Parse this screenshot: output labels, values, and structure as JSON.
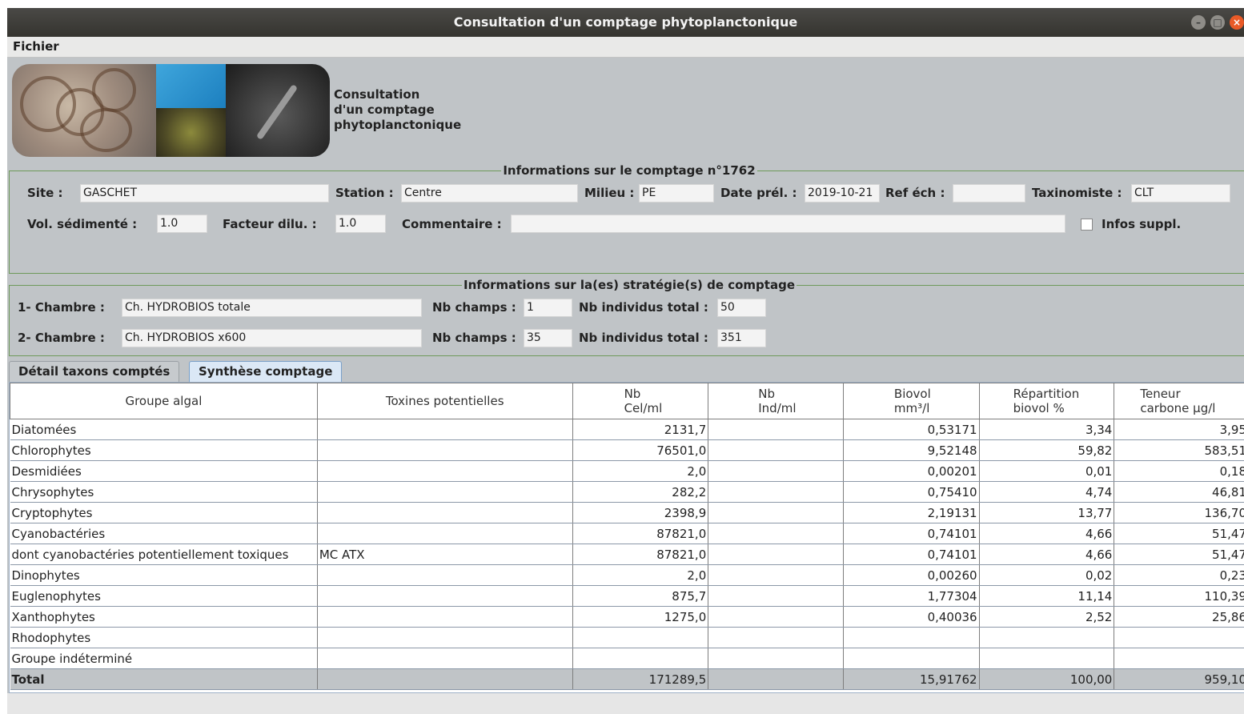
{
  "window": {
    "title": "Consultation d'un comptage phytoplanctonique"
  },
  "menu": {
    "fichier": "Fichier"
  },
  "banner": {
    "caption": [
      "Consultation",
      "d'un comptage",
      "phytoplanctonique"
    ]
  },
  "info": {
    "legend": "Informations sur le comptage n°1762",
    "site_label": "Site :",
    "site_value": "GASCHET",
    "station_label": "Station :",
    "station_value": "Centre",
    "milieu_label": "Milieu :",
    "milieu_value": "PE",
    "date_label": "Date prél. :",
    "date_value": "2019-10-21",
    "ref_label": "Ref éch :",
    "ref_value": "",
    "taxo_label": "Taxinomiste :",
    "taxo_value": "CLT",
    "vol_label": "Vol. sédimenté :",
    "vol_value": "1.0",
    "facteur_label": "Facteur dilu. :",
    "facteur_value": "1.0",
    "commentaire_label": "Commentaire :",
    "commentaire_value": "",
    "infos_suppl_label": "Infos suppl."
  },
  "strategy": {
    "legend": "Informations sur la(es) stratégie(s) de comptage",
    "rows": [
      {
        "chambre_label": "1- Chambre :",
        "chambre_value": "Ch. HYDROBIOS totale",
        "champs_label": "Nb champs :",
        "champs_value": "1",
        "indiv_label": "Nb individus total :",
        "indiv_value": "50"
      },
      {
        "chambre_label": "2- Chambre :",
        "chambre_value": "Ch. HYDROBIOS x600",
        "champs_label": "Nb champs :",
        "champs_value": "35",
        "indiv_label": "Nb individus total :",
        "indiv_value": "351"
      }
    ]
  },
  "tabs": [
    {
      "label": "Détail taxons comptés",
      "active": false
    },
    {
      "label": "Synthèse comptage",
      "active": true
    }
  ],
  "table": {
    "headers": [
      [
        "Groupe algal"
      ],
      [
        "Toxines potentielles"
      ],
      [
        "Nb",
        "Cel/ml"
      ],
      [
        "Nb",
        "Ind/ml"
      ],
      [
        "Biovol",
        "mm³/l"
      ],
      [
        "Répartition",
        "biovol %"
      ],
      [
        "Teneur",
        "carbone µg/l"
      ]
    ],
    "rows": [
      [
        "Diatomées",
        "",
        "2131,7",
        "",
        "0,53171",
        "3,34",
        "3,95"
      ],
      [
        "Chlorophytes",
        "",
        "76501,0",
        "",
        "9,52148",
        "59,82",
        "583,51"
      ],
      [
        "Desmidiées",
        "",
        "2,0",
        "",
        "0,00201",
        "0,01",
        "0,18"
      ],
      [
        "Chrysophytes",
        "",
        "282,2",
        "",
        "0,75410",
        "4,74",
        "46,81"
      ],
      [
        "Cryptophytes",
        "",
        "2398,9",
        "",
        "2,19131",
        "13,77",
        "136,70"
      ],
      [
        "Cyanobactéries",
        "",
        "87821,0",
        "",
        "0,74101",
        "4,66",
        "51,47"
      ],
      [
        "dont cyanobactéries potentiellement toxiques",
        "MC ATX",
        "87821,0",
        "",
        "0,74101",
        "4,66",
        "51,47"
      ],
      [
        "Dinophytes",
        "",
        "2,0",
        "",
        "0,00260",
        "0,02",
        "0,23"
      ],
      [
        "Euglenophytes",
        "",
        "875,7",
        "",
        "1,77304",
        "11,14",
        "110,39"
      ],
      [
        "Xanthophytes",
        "",
        "1275,0",
        "",
        "0,40036",
        "2,52",
        "25,86"
      ],
      [
        "Rhodophytes",
        "",
        "",
        "",
        "",
        "",
        ""
      ],
      [
        "Groupe indéterminé",
        "",
        "",
        "",
        "",
        "",
        ""
      ]
    ],
    "total": [
      "Total",
      "",
      "171289,5",
      "",
      "15,91762",
      "100,00",
      "959,10"
    ]
  }
}
